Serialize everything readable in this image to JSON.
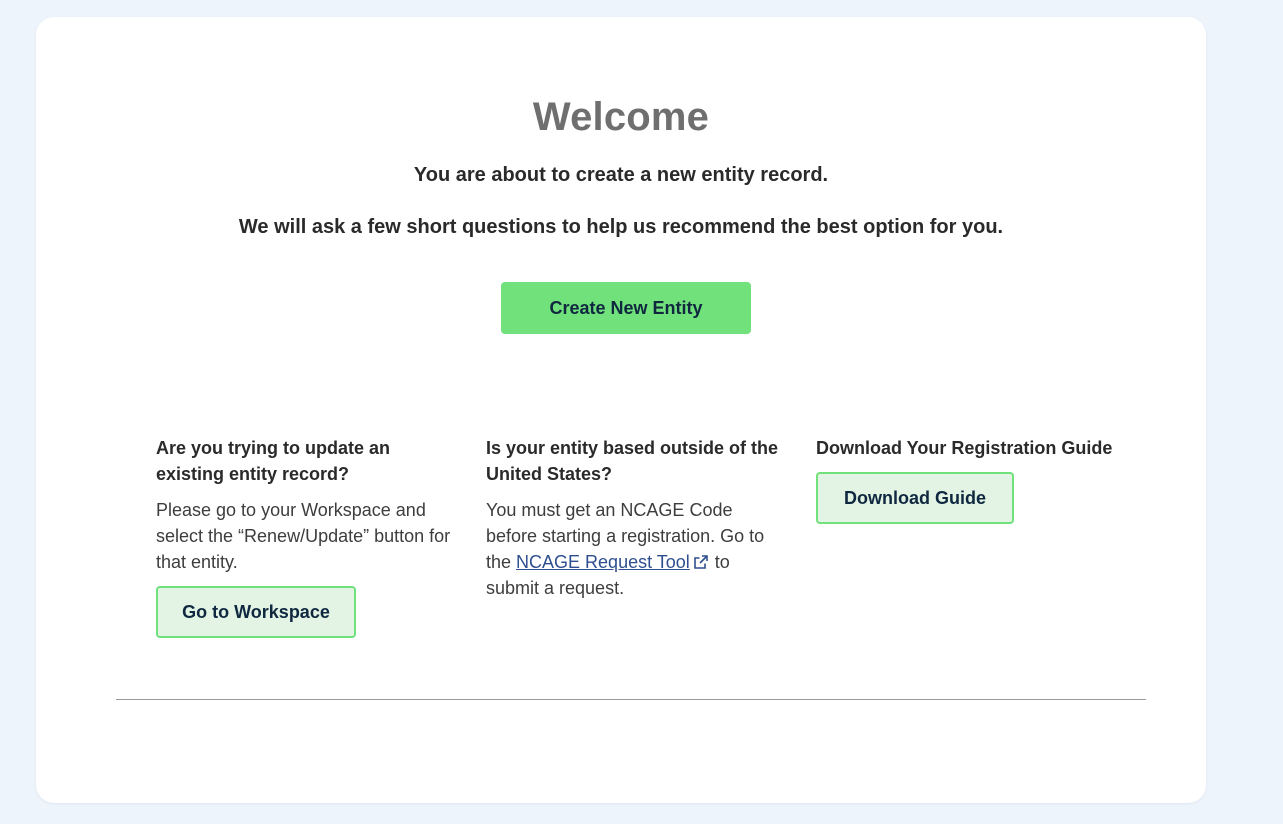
{
  "welcome": {
    "title": "Welcome",
    "line1": "You are about to create a new entity record.",
    "line2": "We will ask a few short questions to help us recommend the best option for you.",
    "create_button": "Create New Entity"
  },
  "columns": {
    "update": {
      "heading": "Are you trying to update an existing entity record?",
      "text": "Please go to your Workspace and select the “Renew/Update” button for that entity.",
      "button": "Go to Workspace"
    },
    "outside_us": {
      "heading": "Is your entity based outside of the United States?",
      "text_before": "You must get an NCAGE Code before starting a registration. Go to the ",
      "link": "NCAGE Request Tool",
      "text_after": " to submit a request."
    },
    "guide": {
      "heading": "Download Your Registration Guide",
      "button": "Download Guide"
    }
  },
  "icons": {
    "external_link": "external-link-icon"
  },
  "colors": {
    "primary_button": "#70e17b",
    "secondary_button_bg": "#e4f4e4",
    "button_text": "#0f2840",
    "link": "#2e4f8f",
    "page_bg": "#eef4fc"
  }
}
